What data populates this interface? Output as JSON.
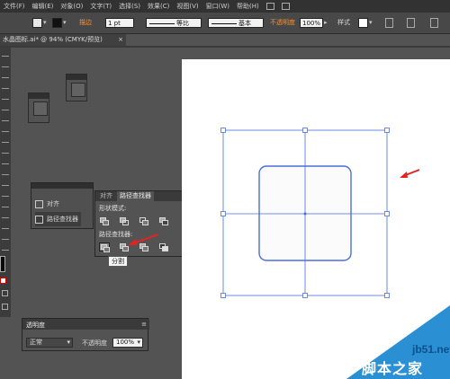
{
  "menubar": {
    "items": [
      "文件(F)",
      "编辑(E)",
      "对象(O)",
      "文字(T)",
      "选择(S)",
      "效果(C)",
      "视图(V)",
      "窗口(W)",
      "帮助(H)"
    ]
  },
  "controlbar": {
    "stroke_label": "描边",
    "stroke_weight": "1 pt",
    "profile_label": "等比",
    "brush_label": "基本",
    "opacity_label": "不透明度",
    "opacity_value": "100%",
    "style_label": "样式"
  },
  "document_tab": {
    "title": "水晶图标.ai* @ 94% (CMYK/预览)",
    "close": "×"
  },
  "panel_group": {
    "align_label": "对齐",
    "pathfinder_label": "路径查找器"
  },
  "pathfinder": {
    "tabs": [
      "对齐",
      "路径查找器"
    ],
    "shape_modes_label": "形状模式:",
    "pathfinders_label": "路径查找器:",
    "expand_label": "扩展"
  },
  "tooltip": {
    "text": "分割"
  },
  "transparency": {
    "title": "透明度",
    "blend_mode": "正常",
    "opacity_label": "不透明度",
    "opacity_value": "100%"
  },
  "watermark": {
    "site": "jb51.net",
    "text": "脚本之家"
  },
  "colors": {
    "selection": "#4a6fd8",
    "annotation_arrow": "#e02424",
    "accent_label": "#f2923a"
  }
}
